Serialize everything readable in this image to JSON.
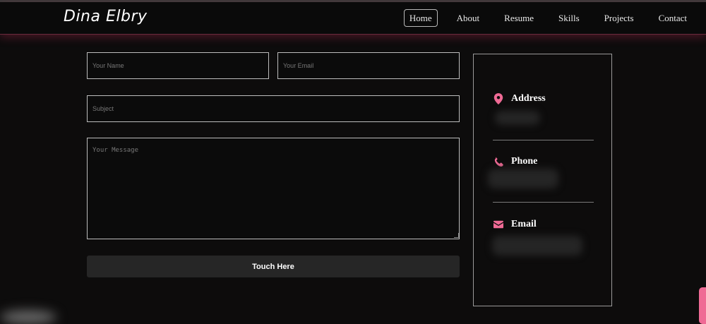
{
  "brand": {
    "name": "Dina Elbry"
  },
  "nav": {
    "items": [
      {
        "label": "Home",
        "active": true
      },
      {
        "label": "About"
      },
      {
        "label": "Resume"
      },
      {
        "label": "Skills"
      },
      {
        "label": "Projects"
      },
      {
        "label": "Contact"
      }
    ]
  },
  "form": {
    "name_placeholder": "Your Name",
    "email_placeholder": "Your Email",
    "subject_placeholder": "Subject",
    "message_placeholder": "Your Message",
    "submit_label": "Touch Here"
  },
  "info": {
    "address_label": "Address",
    "phone_label": "Phone",
    "email_label": "Email"
  },
  "colors": {
    "accent": "#ef6a95",
    "background": "#0d0c0c",
    "button_bg": "#262626"
  },
  "icons": {
    "address": "map-marker-icon",
    "phone": "phone-icon",
    "email": "envelope-icon"
  }
}
